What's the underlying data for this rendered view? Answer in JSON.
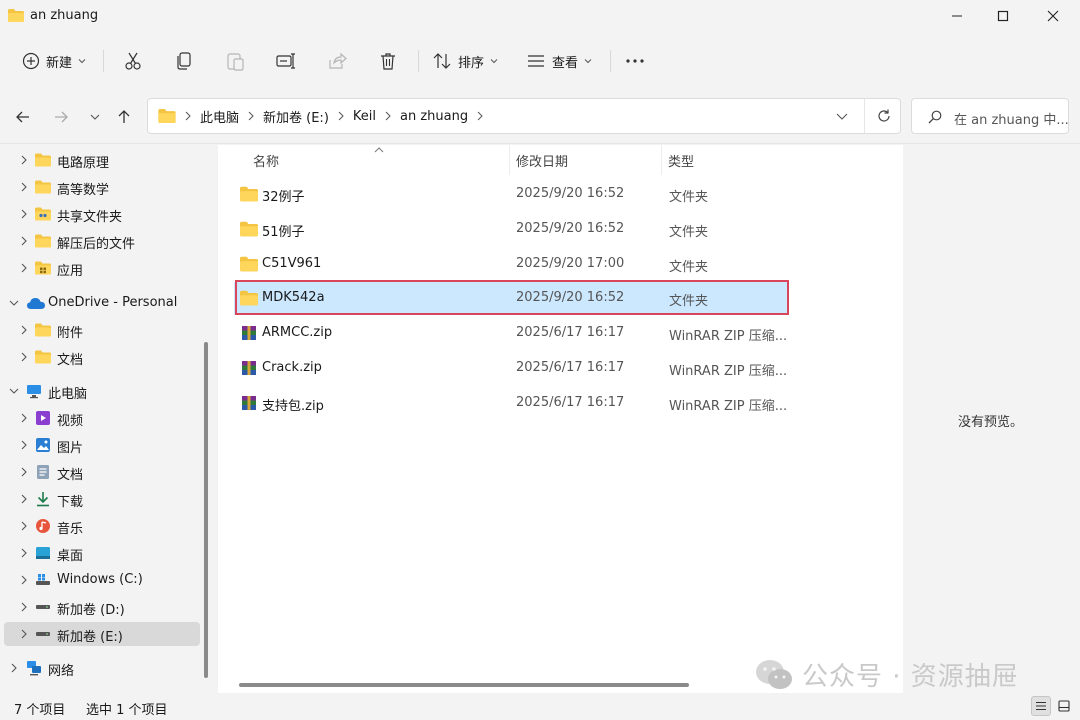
{
  "window": {
    "title": "an zhuang"
  },
  "toolbar": {
    "new_label": "新建",
    "sort_label": "排序",
    "view_label": "查看"
  },
  "address": {
    "crumbs": [
      "此电脑",
      "新加卷 (E:)",
      "Keil",
      "an zhuang"
    ],
    "search_placeholder": "在 an zhuang 中..."
  },
  "sidebar": {
    "items": [
      {
        "label": "电路原理",
        "icon": "folder-icon"
      },
      {
        "label": "高等数学",
        "icon": "folder-icon"
      },
      {
        "label": "共享文件夹",
        "icon": "shared-folder-icon"
      },
      {
        "label": "解压后的文件",
        "icon": "folder-icon"
      },
      {
        "label": "应用",
        "icon": "apps-folder-icon"
      },
      {
        "label": "OneDrive - Personal",
        "icon": "cloud-icon"
      },
      {
        "label": "附件",
        "icon": "folder-icon"
      },
      {
        "label": "文档",
        "icon": "folder-icon"
      },
      {
        "label": "此电脑",
        "icon": "computer-icon"
      },
      {
        "label": "视频",
        "icon": "video-icon"
      },
      {
        "label": "图片",
        "icon": "picture-icon"
      },
      {
        "label": "文档",
        "icon": "document-icon"
      },
      {
        "label": "下载",
        "icon": "download-icon"
      },
      {
        "label": "音乐",
        "icon": "music-icon"
      },
      {
        "label": "桌面",
        "icon": "desktop-icon"
      },
      {
        "label": "Windows (C:)",
        "icon": "windows-drive-icon"
      },
      {
        "label": "新加卷 (D:)",
        "icon": "drive-icon"
      },
      {
        "label": "新加卷 (E:)",
        "icon": "drive-icon"
      },
      {
        "label": "网络",
        "icon": "network-icon"
      }
    ]
  },
  "columns": {
    "name": "名称",
    "date": "修改日期",
    "type": "类型"
  },
  "files": [
    {
      "name": "32例子",
      "date": "2025/9/20 16:52",
      "type": "文件夹",
      "icon": "folder-icon"
    },
    {
      "name": "51例子",
      "date": "2025/9/20 16:52",
      "type": "文件夹",
      "icon": "folder-icon"
    },
    {
      "name": "C51V961",
      "date": "2025/9/20 17:00",
      "type": "文件夹",
      "icon": "folder-icon"
    },
    {
      "name": "MDK542a",
      "date": "2025/9/20 16:52",
      "type": "文件夹",
      "icon": "folder-icon"
    },
    {
      "name": "ARMCC.zip",
      "date": "2025/6/17 16:17",
      "type": "WinRAR ZIP 压缩...",
      "icon": "winrar-zip-icon"
    },
    {
      "name": "Crack.zip",
      "date": "2025/6/17 16:17",
      "type": "WinRAR ZIP 压缩...",
      "icon": "winrar-zip-icon"
    },
    {
      "name": "支持包.zip",
      "date": "2025/6/17 16:17",
      "type": "WinRAR ZIP 压缩...",
      "icon": "winrar-zip-icon"
    }
  ],
  "preview": {
    "message": "没有预览。"
  },
  "status": {
    "count": "7 个项目",
    "selected": "选中 1 个项目"
  },
  "watermark": {
    "text": "公众号 · 资源抽屉"
  },
  "colors": {
    "selection": "#cce8ff",
    "highlight_border": "#d9455a",
    "folder": "#f4c542"
  }
}
